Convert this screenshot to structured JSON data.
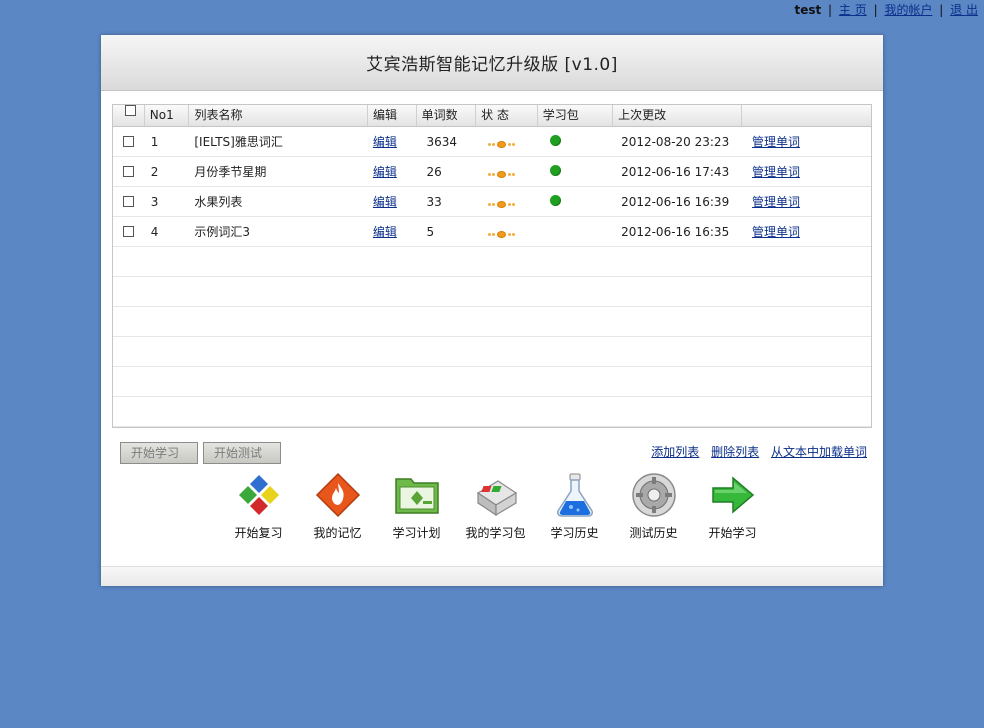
{
  "topbar": {
    "user": "test",
    "links": [
      "主 页",
      "我的帐户",
      "退 出"
    ]
  },
  "header": {
    "title": "艾宾浩斯智能记忆升级版 [v1.0]"
  },
  "table": {
    "columns": [
      "No1",
      "列表名称",
      "编辑",
      "单词数",
      "状 态",
      "学习包",
      "上次更改",
      ""
    ],
    "rows": [
      {
        "no": "1",
        "name": "[IELTS]雅思词汇",
        "edit": "编辑",
        "count": "3634",
        "pack": true,
        "date": "2012-08-20 23:23",
        "manage": "管理单词"
      },
      {
        "no": "2",
        "name": "月份季节星期",
        "edit": "编辑",
        "count": "26",
        "pack": true,
        "date": "2012-06-16 17:43",
        "manage": "管理单词"
      },
      {
        "no": "3",
        "name": "水果列表",
        "edit": "编辑",
        "count": "33",
        "pack": true,
        "date": "2012-06-16 16:39",
        "manage": "管理单词"
      },
      {
        "no": "4",
        "name": "示例词汇3",
        "edit": "编辑",
        "count": "5",
        "pack": false,
        "date": "2012-06-16 16:35",
        "manage": "管理单词"
      }
    ]
  },
  "buttons": {
    "start_study": "开始学习",
    "start_test": "开始测试"
  },
  "actions": [
    "添加列表",
    "删除列表",
    "从文本中加载单词"
  ],
  "icons": [
    {
      "name": "review-icon",
      "label": "开始复习"
    },
    {
      "name": "memory-icon",
      "label": "我的记忆"
    },
    {
      "name": "plan-icon",
      "label": "学习计划"
    },
    {
      "name": "package-icon",
      "label": "我的学习包"
    },
    {
      "name": "history-icon",
      "label": "学习历史"
    },
    {
      "name": "test-history-icon",
      "label": "测试历史"
    },
    {
      "name": "start-icon",
      "label": "开始学习"
    }
  ],
  "colors": {
    "background": "#5b87c5",
    "link": "#0b2f8a",
    "status_green": "#20a020",
    "status_orange": "#f29a1c"
  }
}
